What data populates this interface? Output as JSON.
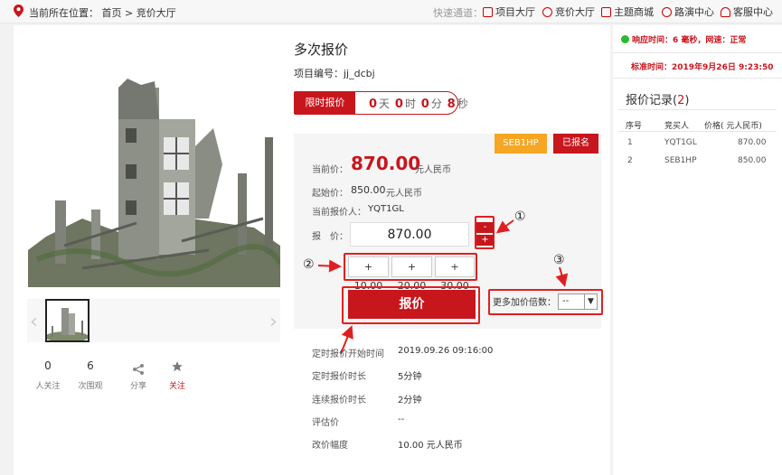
{
  "breadcrumb": {
    "label": "当前所在位置：",
    "home": "首页",
    "sep": ">",
    "current": "竞价大厅"
  },
  "quicknav": {
    "label": "快速通道：",
    "items": [
      {
        "label": "项目大厅",
        "icon": "document-icon"
      },
      {
        "label": "竞价大厅",
        "icon": "auction-icon"
      },
      {
        "label": "主题商城",
        "icon": "grid-icon"
      },
      {
        "label": "路演中心",
        "icon": "play-icon"
      },
      {
        "label": "客服中心",
        "icon": "headset-icon"
      }
    ]
  },
  "gallery": {
    "prev": "‹",
    "next": "›"
  },
  "stats": [
    {
      "value": "0",
      "label": "人关注"
    },
    {
      "value": "6",
      "label": "次围观"
    }
  ],
  "actions": {
    "share": "分享",
    "follow": "关注"
  },
  "project": {
    "title": "多次报价",
    "code_label": "项目编号：",
    "code": "jj_dcbj"
  },
  "timer": {
    "label": "限时报价",
    "days": "0",
    "days_unit": "天",
    "hours": "0",
    "hours_unit": "时",
    "minutes": "0",
    "minutes_unit": "分",
    "seconds": "8",
    "seconds_unit": "秒"
  },
  "bid": {
    "user_badge": "SEB1HP",
    "status_badge": "已报名",
    "current_label": "当前价：",
    "current_price": "870.00",
    "currency": "元人民币",
    "start_label": "起始价：",
    "start_price": "850.00",
    "bidder_label": "当前报价人：",
    "bidder": "YQT1GL",
    "price_label": "报　价：",
    "price_value": "870.00",
    "minus": "-",
    "plus": "+",
    "increments": [
      "+ 10.00",
      "+ 20.00",
      "+ 30.00"
    ],
    "submit": "报价",
    "more_label": "更多加价倍数：",
    "more_value": "--"
  },
  "annotations": {
    "one": "①",
    "two": "②",
    "three": "③"
  },
  "details": [
    {
      "label": "定时报价开始时间",
      "value": "2019.09.26 09:16:00"
    },
    {
      "label": "定时报价时长",
      "value": "5分钟"
    },
    {
      "label": "连续报价时长",
      "value": "2分钟"
    },
    {
      "label": "评估价",
      "value": "--"
    },
    {
      "label": "改价幅度",
      "value": "10.00 元人民币"
    }
  ],
  "side": {
    "response": "响应时间：6 毫秒，网速：正常",
    "standard_time": "标准时间：2019年9月26日 9:23:50",
    "records_title": "报价记录(",
    "records_count": "2",
    "records_close": ")",
    "headers": [
      "序号",
      "竞买人",
      "价格( 元人民币)"
    ],
    "rows": [
      [
        "1",
        "YQT1GL",
        "870.00"
      ],
      [
        "2",
        "SEB1HP",
        "850.00"
      ]
    ]
  },
  "colors": {
    "accent": "#c8161d",
    "badge": "#f5a623",
    "ok": "#2db92d"
  }
}
